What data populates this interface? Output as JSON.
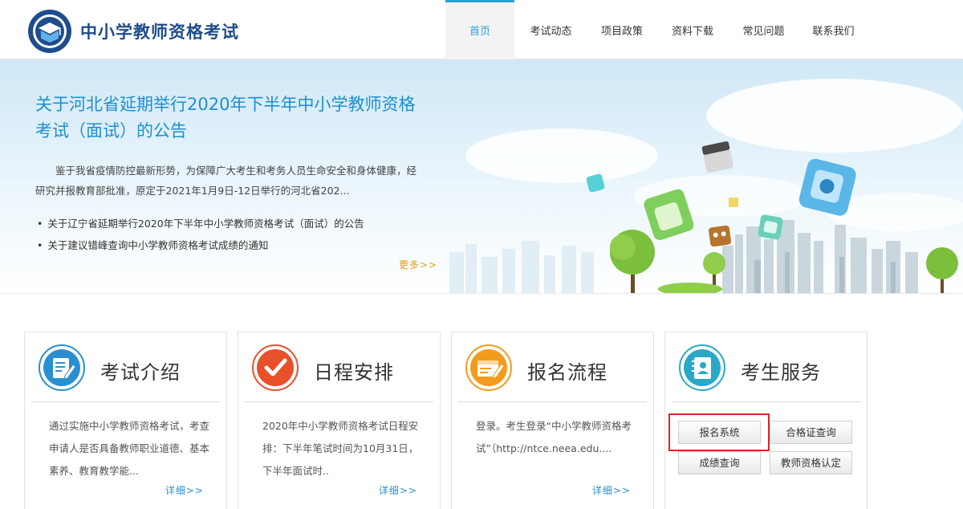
{
  "header": {
    "site_title": "中小学教师资格考试",
    "nav": [
      "首页",
      "考试动态",
      "项目政策",
      "资料下载",
      "常见问题",
      "联系我们"
    ],
    "active_nav": 0,
    "accent_color": "#2aa0d8"
  },
  "banner": {
    "news_title": "关于河北省延期举行2020年下半年中小学教师资格考试（面试）的公告",
    "summary": "鉴于我省疫情防控最新形势，为保障广大考生和考务人员生命安全和身体健康，经研究并报教育部批准，原定于2021年1月9日-12日举行的河北省202...",
    "news_list": [
      "关于辽宁省延期举行2020年下半年中小学教师资格考试（面试）的公告",
      "关于建议错峰查询中小学教师资格考试成绩的通知"
    ],
    "more": "更多>>"
  },
  "cards": [
    {
      "title": "考试介绍",
      "icon": "document-pen-icon",
      "icon_color": "#2a8fd0",
      "text": "通过实施中小学教师资格考试，考查申请人是否具备教师职业道德、基本素养、教育教学能...",
      "more": "详细>>"
    },
    {
      "title": "日程安排",
      "icon": "checkmark-icon",
      "icon_color": "#e8502a",
      "text": "2020年中小学教师资格考试日程安排：下半年笔试时间为10月31日，下半年面试时..",
      "more": "详细>>"
    },
    {
      "title": "报名流程",
      "icon": "form-pen-icon",
      "icon_color": "#f29b1d",
      "text": "登录。考生登录“中小学教师资格考试”（http://ntce.neea.edu....",
      "more": "详细>>"
    },
    {
      "title": "考生服务",
      "icon": "contact-book-icon",
      "icon_color": "#2aa8c8",
      "buttons": [
        "报名系统",
        "合格证查询",
        "成绩查询",
        "教师资格认定"
      ]
    }
  ],
  "highlight_color": "#d9252a"
}
